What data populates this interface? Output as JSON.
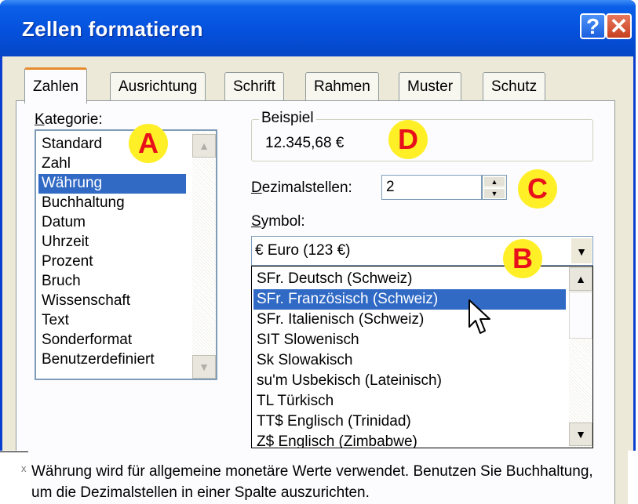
{
  "window": {
    "title": "Zellen formatieren",
    "help_label": "?",
    "close_label": "✕"
  },
  "tabs": [
    {
      "label": "Zahlen",
      "active": true
    },
    {
      "label": "Ausrichtung"
    },
    {
      "label": "Schrift"
    },
    {
      "label": "Rahmen"
    },
    {
      "label": "Muster"
    },
    {
      "label": "Schutz"
    }
  ],
  "category": {
    "label_prefix": "K",
    "label_rest": "ategorie:",
    "items": [
      "Standard",
      "Zahl",
      "Währung",
      "Buchhaltung",
      "Datum",
      "Uhrzeit",
      "Prozent",
      "Bruch",
      "Wissenschaft",
      "Text",
      "Sonderformat",
      "Benutzerdefiniert"
    ],
    "selected": "Währung"
  },
  "sample": {
    "caption": "Beispiel",
    "value": "12.345,68 €"
  },
  "decimals": {
    "label_prefix": "D",
    "label_rest": "ezimalstellen:",
    "value": "2"
  },
  "symbol": {
    "label_prefix": "S",
    "label_rest": "ymbol:",
    "value": "€ Euro (123 €)",
    "options": [
      "SFr. Deutsch (Schweiz)",
      "SFr. Französisch (Schweiz)",
      "SFr. Italienisch (Schweiz)",
      "SIT Slowenisch",
      "Sk Slowakisch",
      "su'm Usbekisch (Lateinisch)",
      "TL Türkisch",
      "TT$ Englisch (Trinidad)",
      "Z$ Englisch (Zimbabwe)"
    ],
    "highlighted": "SFr. Französisch (Schweiz)"
  },
  "description": "Währung wird für allgemeine monetäre Werte verwendet. Benutzen Sie Buchhaltung, um die Dezimalstellen in einer Spalte auszurichten.",
  "annotations": {
    "a": "A",
    "b": "B",
    "c": "C",
    "d": "D"
  },
  "outside": {
    "char": "x"
  },
  "colors": {
    "title_bar": "#0551dc",
    "selection": "#316ac5",
    "badge_fill": "#ffef27",
    "badge_text": "#e8101a",
    "active_tab_accent": "#e68b2c"
  }
}
